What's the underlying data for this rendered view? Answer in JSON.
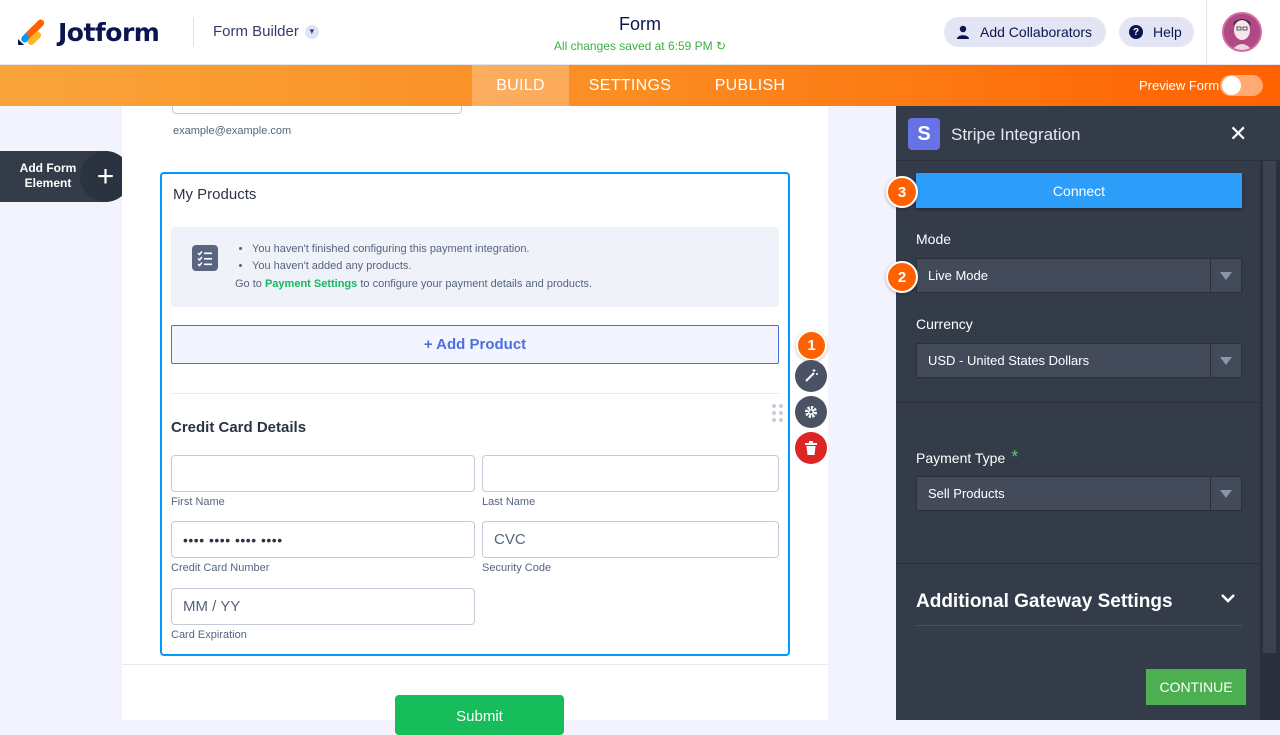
{
  "header": {
    "logo_text": "Jotform",
    "mode_label": "Form Builder",
    "form_title": "Form",
    "saved_status": "All changes saved at 6:59 PM",
    "collaborators_label": "Add Collaborators",
    "help_label": "Help"
  },
  "nav": {
    "tabs": [
      {
        "label": "BUILD"
      },
      {
        "label": "SETTINGS"
      },
      {
        "label": "PUBLISH"
      }
    ],
    "preview_label": "Preview Form"
  },
  "left": {
    "add_element_label": "Add Form Element",
    "add_icon": "+"
  },
  "form": {
    "email_hint": "example@example.com",
    "products_title": "My Products",
    "notice_items": [
      "You haven't finished configuring this payment integration.",
      "You haven't added any products."
    ],
    "notice_prefix": "Go to",
    "notice_link": "Payment Settings",
    "notice_suffix": "to configure your payment details and products.",
    "add_product_label": "+ Add Product",
    "cc_title": "Credit Card Details",
    "first_name_label": "First Name",
    "last_name_label": "Last Name",
    "cc_number_value": "•••• •••• •••• ••••",
    "cc_number_label": "Credit Card Number",
    "cvc_placeholder": "CVC",
    "cvc_label": "Security Code",
    "expiry_placeholder": "MM / YY",
    "expiry_label": "Card Expiration",
    "submit_label": "Submit",
    "badge_1": "1"
  },
  "panel": {
    "title": "Stripe Integration",
    "logo_letter": "S",
    "close_icon": "✕",
    "connect_label": "Connect",
    "badge_3": "3",
    "mode_label": "Mode",
    "mode_value": "Live Mode",
    "badge_2": "2",
    "currency_label": "Currency",
    "currency_value": "USD - United States Dollars",
    "payment_type_label": "Payment Type",
    "required_mark": "*",
    "payment_type_value": "Sell Products",
    "additional_label": "Additional Gateway Settings",
    "continue_label": "CONTINUE"
  },
  "colors": {
    "brand_orange": "#ff6100",
    "connect_blue": "#2c9ef9",
    "continue_green": "#4caf50",
    "submit_green": "#18bd5b",
    "panel_bg": "#343c4a"
  }
}
